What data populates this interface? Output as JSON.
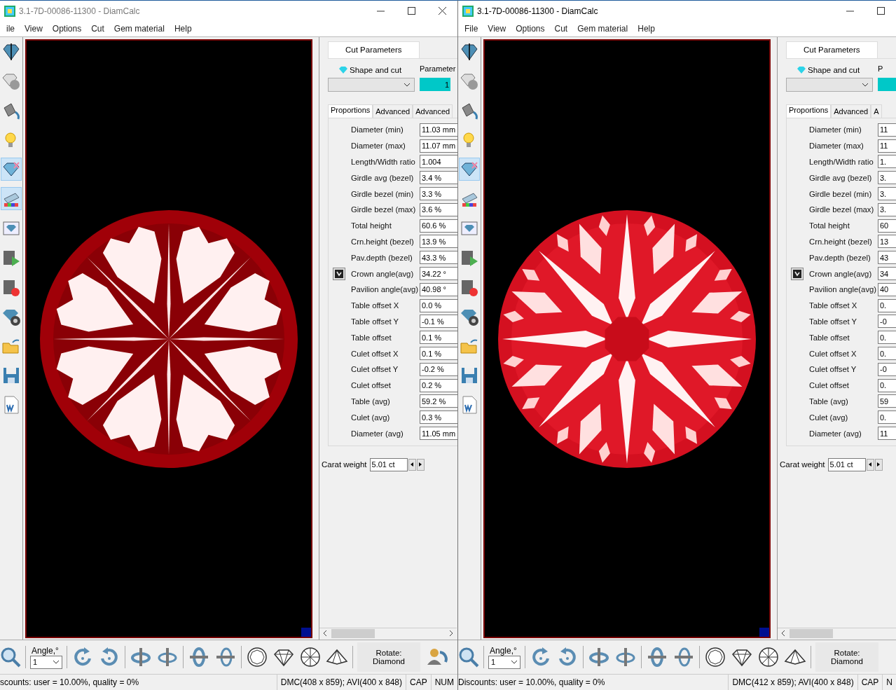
{
  "windows": [
    {
      "active": false,
      "title": "3.1-7D-00086-11300 - DiamCalc",
      "title_buttons": [
        {
          "kind": "minimize"
        },
        {
          "kind": "maximize"
        },
        {
          "kind": "close"
        }
      ],
      "menu": [
        "ile",
        "View",
        "Options",
        "Cut",
        "Gem material",
        "Help"
      ],
      "tools": [
        {
          "selected": false
        },
        {
          "selected": false
        },
        {
          "selected": false
        },
        {
          "selected": false
        },
        {
          "selected": true
        },
        {
          "selected": true
        },
        {
          "selected": false
        },
        {
          "selected": false
        },
        {
          "selected": false
        },
        {
          "selected": false
        },
        {
          "selected": false
        },
        {
          "selected": false
        },
        {
          "selected": false
        }
      ],
      "kind": "hearts",
      "panel": {
        "tab": {
          "label": "Cut Parameters",
          "selected": true
        },
        "shape_label": "Shape and cut",
        "parameter_label": "Parameter",
        "parameter_value": "1",
        "subtabs": [
          {
            "label": "Proportions",
            "selected": true
          },
          {
            "label": "Advanced",
            "selected": false
          },
          {
            "label": "Advanced",
            "selected": false
          }
        ],
        "rows": [
          {
            "label": "Diameter (min)",
            "value": "11.03 mm",
            "has_toggle": false
          },
          {
            "label": "Diameter (max)",
            "value": "11.07 mm",
            "has_toggle": false
          },
          {
            "label": "Length/Width ratio",
            "value": "1.004",
            "has_toggle": false
          },
          {
            "label": "Girdle avg (bezel)",
            "value": "3.4 %",
            "has_toggle": false
          },
          {
            "label": "Girdle bezel (min)",
            "value": "3.3 %",
            "has_toggle": false
          },
          {
            "label": "Girdle bezel (max)",
            "value": "3.6 %",
            "has_toggle": false
          },
          {
            "label": "Total height",
            "value": "60.6 %",
            "has_toggle": false
          },
          {
            "label": "Crn.height (bezel)",
            "value": "13.9 %",
            "has_toggle": false
          },
          {
            "label": "Pav.depth (bezel)",
            "value": "43.3 %",
            "has_toggle": false
          },
          {
            "label": "Crown angle(avg)",
            "value": "34.22 °",
            "has_toggle": true
          },
          {
            "label": "Pavilion angle(avg)",
            "value": "40.98 °",
            "has_toggle": false
          },
          {
            "label": "Table offset X",
            "value": "0.0 %",
            "has_toggle": false
          },
          {
            "label": "Table offset Y",
            "value": "-0.1 %",
            "has_toggle": false
          },
          {
            "label": "Table offset",
            "value": "0.1 %",
            "has_toggle": false
          },
          {
            "label": "Culet offset X",
            "value": "0.1 %",
            "has_toggle": false
          },
          {
            "label": "Culet offset Y",
            "value": "-0.2 %",
            "has_toggle": false
          },
          {
            "label": "Culet offset",
            "value": "0.2 %",
            "has_toggle": false
          },
          {
            "label": "Table (avg)",
            "value": "59.2 %",
            "has_toggle": false
          },
          {
            "label": "Culet (avg)",
            "value": "0.3 %",
            "has_toggle": false
          },
          {
            "label": "Diameter (avg)",
            "value": "11.05 mm",
            "has_toggle": false
          }
        ],
        "carat_label": "Carat weight",
        "carat_value": "5.01 ct"
      },
      "toolbar": {
        "angle_label": "Angle,°",
        "angle_value": "1",
        "rotate_label": "Rotate:",
        "rotate_target": "Diamond",
        "user_rotate_icon": true
      },
      "status": [
        "scounts: user = 10.00%, quality = 0%",
        "DMC(408 x 859); AVI(400 x 848)",
        "CAP",
        "NUM"
      ]
    },
    {
      "active": true,
      "title": "3.1-7D-00086-11300 - DiamCalc",
      "title_buttons": [
        {
          "kind": "minimize"
        },
        {
          "kind": "maximize"
        }
      ],
      "menu": [
        "File",
        "View",
        "Options",
        "Cut",
        "Gem material",
        "Help"
      ],
      "tools": [
        {
          "selected": false
        },
        {
          "selected": false
        },
        {
          "selected": false
        },
        {
          "selected": false
        },
        {
          "selected": true
        },
        {
          "selected": false
        },
        {
          "selected": false
        },
        {
          "selected": false
        },
        {
          "selected": false
        },
        {
          "selected": false
        },
        {
          "selected": false
        },
        {
          "selected": false
        },
        {
          "selected": false
        }
      ],
      "kind": "arrows",
      "panel": {
        "tab": {
          "label": "Cut Parameters",
          "selected": true
        },
        "shape_label": "Shape and cut",
        "parameter_label": "P",
        "subtabs": [
          {
            "label": "Proportions",
            "selected": true
          },
          {
            "label": "Advanced",
            "selected": false
          },
          {
            "label": "A",
            "selected": false
          }
        ],
        "rows": [
          {
            "label": "Diameter (min)",
            "value": "11",
            "has_toggle": false
          },
          {
            "label": "Diameter (max)",
            "value": "11",
            "has_toggle": false
          },
          {
            "label": "Length/Width ratio",
            "value": "1.",
            "has_toggle": false
          },
          {
            "label": "Girdle avg (bezel)",
            "value": "3.",
            "has_toggle": false
          },
          {
            "label": "Girdle bezel (min)",
            "value": "3.",
            "has_toggle": false
          },
          {
            "label": "Girdle bezel (max)",
            "value": "3.",
            "has_toggle": false
          },
          {
            "label": "Total height",
            "value": "60",
            "has_toggle": false
          },
          {
            "label": "Crn.height (bezel)",
            "value": "13",
            "has_toggle": false
          },
          {
            "label": "Pav.depth (bezel)",
            "value": "43",
            "has_toggle": false
          },
          {
            "label": "Crown angle(avg)",
            "value": "34",
            "has_toggle": true
          },
          {
            "label": "Pavilion angle(avg)",
            "value": "40",
            "has_toggle": false
          },
          {
            "label": "Table offset X",
            "value": "0.",
            "has_toggle": false
          },
          {
            "label": "Table offset Y",
            "value": "-0",
            "has_toggle": false
          },
          {
            "label": "Table offset",
            "value": "0.",
            "has_toggle": false
          },
          {
            "label": "Culet offset X",
            "value": "0.",
            "has_toggle": false
          },
          {
            "label": "Culet offset Y",
            "value": "-0",
            "has_toggle": false
          },
          {
            "label": "Culet offset",
            "value": "0.",
            "has_toggle": false
          },
          {
            "label": "Table (avg)",
            "value": "59",
            "has_toggle": false
          },
          {
            "label": "Culet (avg)",
            "value": "0.",
            "has_toggle": false
          },
          {
            "label": "Diameter (avg)",
            "value": "11",
            "has_toggle": false
          }
        ],
        "carat_label": "Carat weight",
        "carat_value": "5.01 ct"
      },
      "toolbar": {
        "angle_label": "Angle,°",
        "angle_value": "1",
        "rotate_label": "Rotate:",
        "rotate_target": "Diamond",
        "user_rotate_icon": false
      },
      "status": [
        "Discounts: user = 10.00%, quality = 0%",
        "DMC(412 x 859); AVI(400 x 848)",
        "CAP",
        "N"
      ]
    }
  ]
}
